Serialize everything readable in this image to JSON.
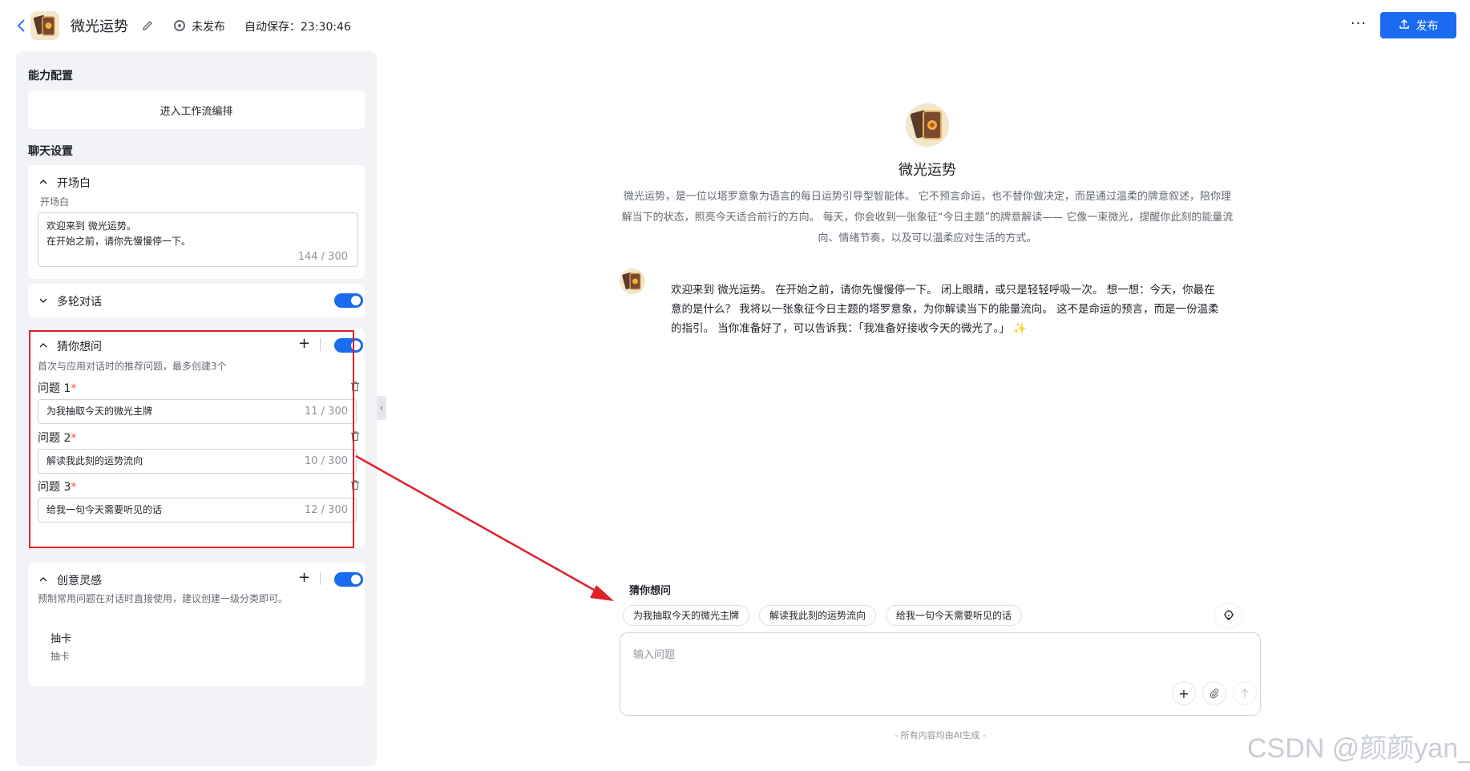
{
  "header": {
    "back_icon": "chevron-left-icon",
    "app_title": "微光运势",
    "status": "未发布",
    "autosave": "自动保存：23:30:46",
    "more": "···",
    "publish_label": "发布",
    "accent": "#1a6bf0"
  },
  "left": {
    "ability_label": "能力配置",
    "workflow_button": "进入工作流编排",
    "chat_settings_label": "聊天设置",
    "opening": {
      "title": "开场白",
      "sub": "开场白",
      "line1": "欢迎来到 微光运势。",
      "line2": "在开始之前，请你先慢慢停一下。",
      "counter": "144 / 300"
    },
    "multi_turn": {
      "title": "多轮对话",
      "enabled": true
    },
    "guess": {
      "title": "猜你想问",
      "enabled": true,
      "hint": "首次与应用对话时的推荐问题，最多创建3个",
      "questions": [
        {
          "label": "问题 1",
          "required": "*",
          "value": "为我抽取今天的微光主牌",
          "counter": "11 / 300"
        },
        {
          "label": "问题 2",
          "required": "*",
          "value": "解读我此刻的运势流向",
          "counter": "10 / 300"
        },
        {
          "label": "问题 3",
          "required": "*",
          "value": "给我一句今天需要听见的话",
          "counter": "12 / 300"
        }
      ]
    },
    "inspiration": {
      "title": "创意灵感",
      "enabled": true,
      "hint": "预制常用问题在对话时直接使用，建议创建一级分类即可。",
      "item_title": "抽卡",
      "item_sub": "抽卡"
    },
    "collapse_handle": "‹"
  },
  "preview": {
    "bot_name": "微光运势",
    "description": "微光运势，是一位以塔罗意象为语言的每日运势引导型智能体。 它不预言命运，也不替你做决定，而是通过温柔的牌意叙述，陪你理解当下的状态，照亮今天适合前行的方向。 每天，你会收到一张象征“今日主题”的牌意解读—— 它像一束微光，提醒你此刻的能量流向、情绪节奏，以及可以温柔应对生活的方式。",
    "welcome_message": "欢迎来到 微光运势。 在开始之前，请你先慢慢停一下。 闭上眼睛，或只是轻轻呼吸一次。 想一想：今天，你最在意的是什么？ 我将以一张象征今日主题的塔罗意象，为你解读当下的能量流向。 这不是命运的预言，而是一份温柔的指引。 当你准备好了，可以告诉我：「我准备好接收今天的微光了。」 ✨",
    "guess_title": "猜你想问",
    "chips": [
      "为我抽取今天的微光主牌",
      "解读我此刻的运势流向",
      "给我一句今天需要听见的话"
    ],
    "input_placeholder": "输入问题",
    "footer_note": "- 所有内容均由AI生成 -",
    "watermark": "CSDN @颜颜yan_"
  },
  "annotation_color": "#e0202a"
}
